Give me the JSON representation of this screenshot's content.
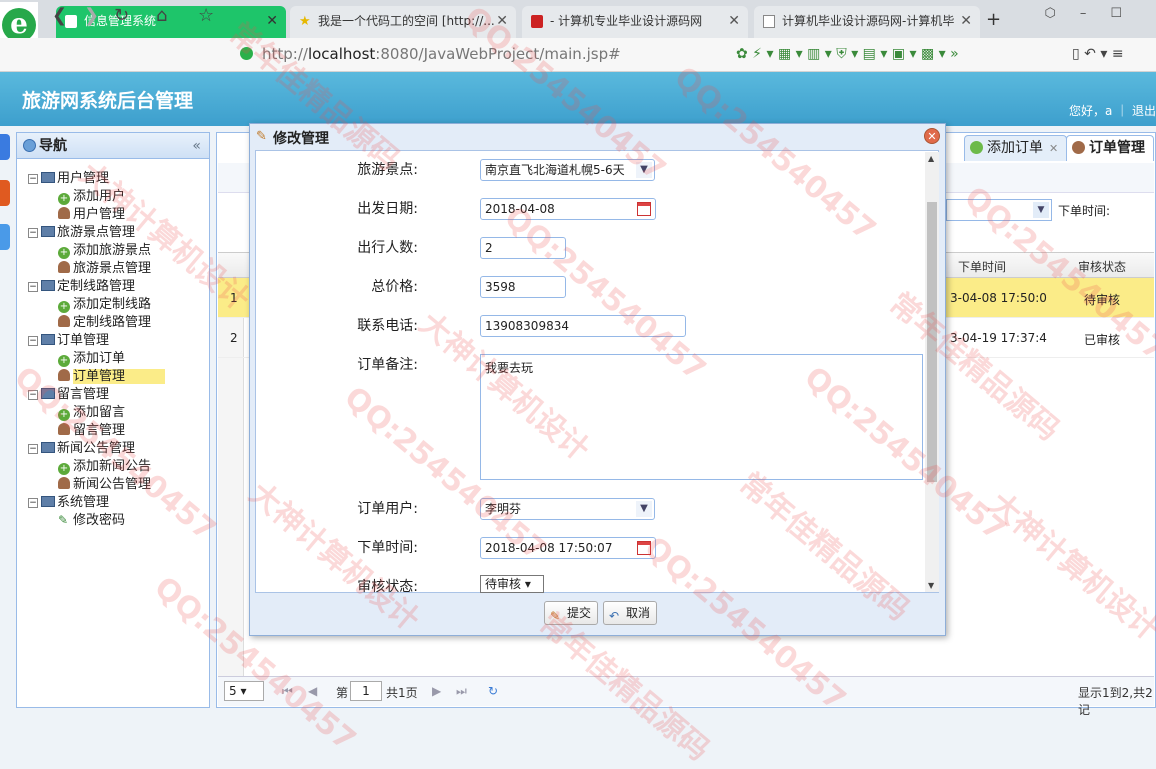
{
  "browser": {
    "tabs": [
      {
        "title": "信息管理系统",
        "active": true
      },
      {
        "title": "我是一个代码工的空间 [http://...",
        "active": false
      },
      {
        "title": "- 计算机专业毕业设计源码网",
        "active": false
      },
      {
        "title": "计算机毕业设计源码网-计算机毕",
        "active": false
      }
    ],
    "url_prefix": "http://",
    "url_host": "localhost",
    "url_rest": ":8080/JavaWebProject/main.jsp#"
  },
  "app": {
    "title": "旅游网系统后台管理",
    "welcome": "您好，a ｜ 退出"
  },
  "sidebar": {
    "title": "导航",
    "groups": [
      {
        "label": "用户管理",
        "items": [
          {
            "label": "添加用户",
            "kind": "add"
          },
          {
            "label": "用户管理",
            "kind": "user"
          }
        ]
      },
      {
        "label": "旅游景点管理",
        "items": [
          {
            "label": "添加旅游景点",
            "kind": "add"
          },
          {
            "label": "旅游景点管理",
            "kind": "user"
          }
        ]
      },
      {
        "label": "定制线路管理",
        "items": [
          {
            "label": "添加定制线路",
            "kind": "add"
          },
          {
            "label": "定制线路管理",
            "kind": "user"
          }
        ]
      },
      {
        "label": "订单管理",
        "items": [
          {
            "label": "添加订单",
            "kind": "add"
          },
          {
            "label": "订单管理",
            "kind": "user",
            "selected": true
          }
        ]
      },
      {
        "label": "留言管理",
        "items": [
          {
            "label": "添加留言",
            "kind": "add"
          },
          {
            "label": "留言管理",
            "kind": "user"
          }
        ]
      },
      {
        "label": "新闻公告管理",
        "items": [
          {
            "label": "添加新闻公告",
            "kind": "add"
          },
          {
            "label": "新闻公告管理",
            "kind": "user"
          }
        ]
      },
      {
        "label": "系统管理",
        "items": [
          {
            "label": "修改密码",
            "kind": "pen"
          }
        ]
      }
    ]
  },
  "content_tabs": [
    {
      "label": "添加订单",
      "closable": true
    },
    {
      "label": "订单管理",
      "active": true
    }
  ],
  "grid": {
    "filter_label": "下单时间:",
    "columns": {
      "order_time": "下单时间",
      "status": "审核状态"
    },
    "rows": [
      {
        "num": "1",
        "order_time": "3-04-08 17:50:0",
        "status": "待审核",
        "selected": true
      },
      {
        "num": "2",
        "order_time": "3-04-19 17:37:4",
        "status": "已审核",
        "selected": false
      }
    ],
    "pager": {
      "page_size": "5",
      "page_prefix": "第",
      "page_value": "1",
      "page_total": "共1页",
      "summary": "显示1到2,共2记"
    }
  },
  "modal": {
    "title": "修改管理",
    "fields": {
      "scenic_label": "旅游景点:",
      "scenic_value": "南京直飞北海道札幌5-6天",
      "date_label": "出发日期:",
      "date_value": "2018-04-08",
      "people_label": "出行人数:",
      "people_value": "2",
      "price_label": "总价格:",
      "price_value": "3598",
      "phone_label": "联系电话:",
      "phone_value": "13908309834",
      "remark_label": "订单备注:",
      "remark_value": "我要去玩",
      "user_label": "订单用户:",
      "user_value": "李明芬",
      "time_label": "下单时间:",
      "time_value": "2018-04-08 17:50:07",
      "status_label": "审核状态:",
      "status_value": "待审核"
    },
    "submit_label": "提交",
    "cancel_label": "取消"
  },
  "watermark": {
    "texts": [
      "QQ:254540457",
      "常年佳精品源码",
      "大神计算机设计"
    ],
    "color": "#eb5050"
  }
}
